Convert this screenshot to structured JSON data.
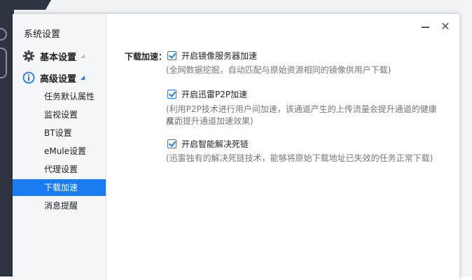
{
  "sidebar": {
    "title": "系统设置",
    "groups": [
      {
        "label": "基本设置",
        "icon": "gear-icon",
        "expanded": false
      },
      {
        "label": "高级设置",
        "icon": "info-icon",
        "expanded": true
      }
    ],
    "items": [
      {
        "label": "任务默认属性"
      },
      {
        "label": "监视设置"
      },
      {
        "label": "BT设置"
      },
      {
        "label": "eMule设置"
      },
      {
        "label": "代理设置"
      },
      {
        "label": "下载加速",
        "active": true
      },
      {
        "label": "消息提醒"
      }
    ]
  },
  "window": {
    "minimize_icon": "minimize-icon",
    "close_icon": "close-icon",
    "close_glyph": "✕"
  },
  "content": {
    "section_label": "下载加速：",
    "options": [
      {
        "label": "开启镜像服务器加速",
        "checked": true,
        "desc": "(全网数据挖掘，自动匹配与原始资源相同的镜像供用户下载)"
      },
      {
        "label": "开启迅雷P2P加速",
        "checked": true,
        "desc_line1": "(利用P2P技术进行用户间加速，该通道产生的上传流量会提升通道的健康度，",
        "desc_line2": "从而提升通道加速效果)"
      },
      {
        "label": "开启智能解决死链",
        "checked": true,
        "desc": "(迅雷独有的解决死链技术，能够将原始下载地址已失效的任务正常下载)"
      }
    ]
  },
  "colors": {
    "accent": "#1a7cf0",
    "sidebar_bg": "#f5f6f8",
    "desc_text": "#777777"
  }
}
